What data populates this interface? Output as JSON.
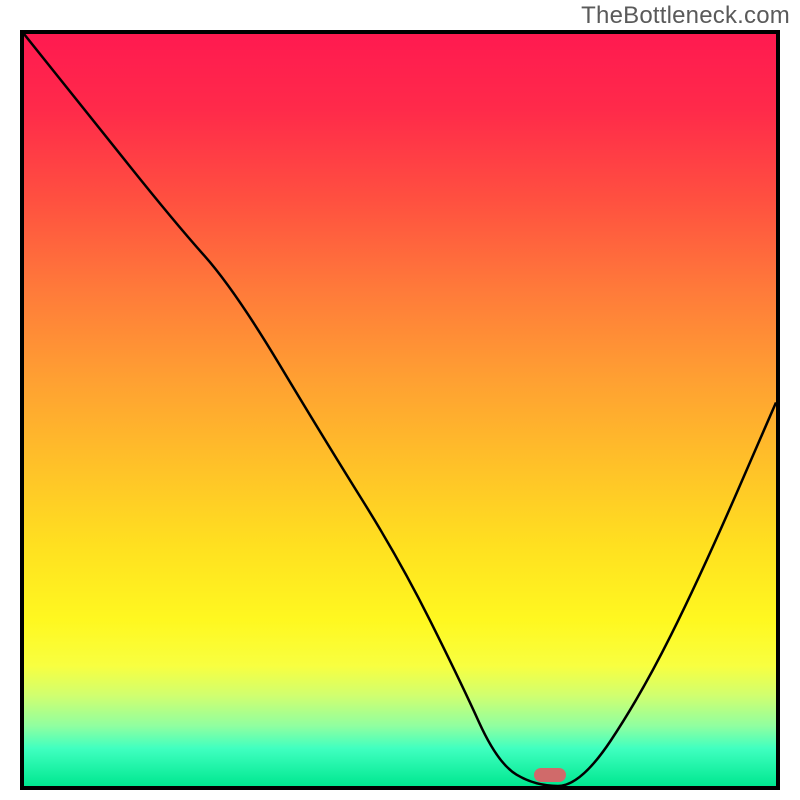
{
  "watermark": "TheBottleneck.com",
  "chart_data": {
    "type": "line",
    "title": "",
    "xlabel": "",
    "ylabel": "",
    "xlim": [
      0,
      100
    ],
    "ylim": [
      0,
      100
    ],
    "grid": false,
    "series": [
      {
        "name": "curve",
        "x": [
          0,
          8,
          20,
          28,
          40,
          50,
          58,
          63,
          68,
          74,
          82,
          90,
          100
        ],
        "values": [
          100,
          90,
          75,
          66,
          46,
          30,
          14,
          3,
          0,
          0,
          12,
          28,
          51
        ]
      }
    ],
    "marker": {
      "x": 70,
      "y": 1.5,
      "color": "#d06a6a"
    },
    "frame_border_color": "#000000",
    "gradient_stops": [
      {
        "pos": 0,
        "color": "#ff1a50"
      },
      {
        "pos": 22,
        "color": "#ff5040"
      },
      {
        "pos": 46,
        "color": "#ffa032"
      },
      {
        "pos": 68,
        "color": "#ffe020"
      },
      {
        "pos": 84,
        "color": "#f8ff40"
      },
      {
        "pos": 95,
        "color": "#40ffc0"
      },
      {
        "pos": 100,
        "color": "#00e890"
      }
    ]
  }
}
